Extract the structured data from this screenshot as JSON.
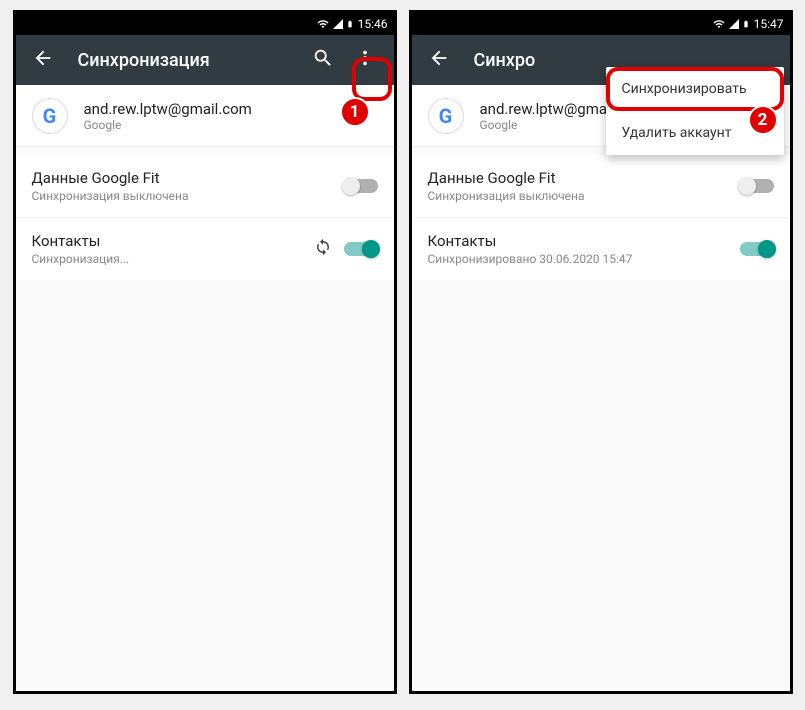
{
  "left": {
    "status": {
      "time": "15:46"
    },
    "appbar": {
      "title": "Синхронизация"
    },
    "account": {
      "email": "and.rew.lptw@gmail.com",
      "provider": "Google"
    },
    "items": [
      {
        "name": "Данные Google Fit",
        "sub": "Синхронизация выключена",
        "on": false,
        "syncing": false
      },
      {
        "name": "Контакты",
        "sub": "Синхронизация...",
        "on": true,
        "syncing": true
      }
    ],
    "badge": "1"
  },
  "right": {
    "status": {
      "time": "15:47"
    },
    "appbar": {
      "title": "Синхро"
    },
    "account": {
      "email": "and.rew.lptw@gmail.com",
      "provider": "Google"
    },
    "items": [
      {
        "name": "Данные Google Fit",
        "sub": "Синхронизация выключена",
        "on": false
      },
      {
        "name": "Контакты",
        "sub": "Синхронизировано 30.06.2020 15:47",
        "on": true
      }
    ],
    "menu": {
      "sync": "Синхронизировать",
      "delete": "Удалить аккаунт"
    },
    "badge": "2"
  }
}
